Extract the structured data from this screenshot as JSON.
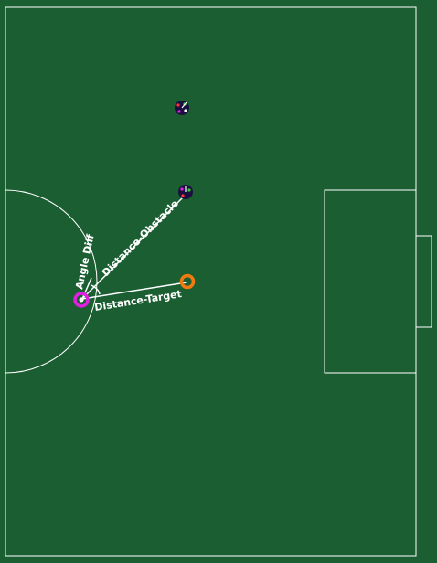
{
  "colors": {
    "pitch": "#1b5e32",
    "line": "#ffffff",
    "agent": "#e020e0",
    "ball": "#f07a10",
    "player_body": "#1a1040",
    "player_marks": [
      "#ff3333",
      "#33cc33",
      "#e020e0",
      "#ffffff"
    ]
  },
  "labels": {
    "angle_diff": "Angle Diff",
    "distance_obstacle": "Distance-Obstacle",
    "distance_target": "Distance-Target"
  },
  "icons": {
    "agent": "magenta-ring-icon",
    "ball": "orange-ball-icon",
    "players": "opponent-player-icon"
  }
}
